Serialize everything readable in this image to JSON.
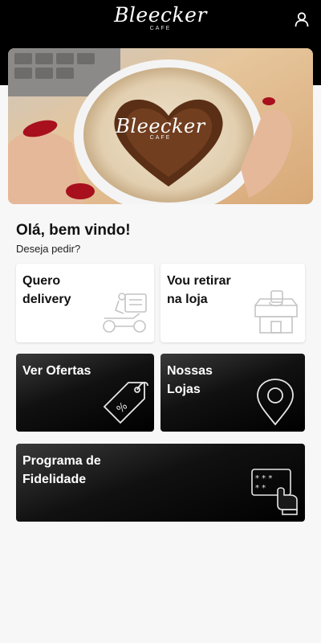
{
  "header": {
    "logo_text": "Bleecker",
    "logo_sub": "CAFE",
    "user_icon": "user-icon"
  },
  "hero": {
    "logo_text": "Bleecker",
    "logo_sub": "CAFE"
  },
  "greeting": {
    "title": "Olá, bem vindo!",
    "subtitle": "Deseja pedir?"
  },
  "cards": [
    {
      "label": "Quero\ndelivery",
      "icon": "delivery-scooter-icon",
      "style": "light"
    },
    {
      "label": "Vou retirar\nna loja",
      "icon": "store-pickup-icon",
      "style": "light"
    },
    {
      "label": "Ver Ofertas",
      "icon": "price-tag-icon",
      "style": "dark"
    },
    {
      "label": "Nossas\nLojas",
      "icon": "location-pin-icon",
      "style": "dark"
    },
    {
      "label": "Programa de\nFidelidade",
      "icon": "loyalty-card-icon",
      "style": "dark"
    }
  ],
  "colors": {
    "topbar": "#000000",
    "background": "#f7f7f7",
    "dark_card": "#000000",
    "light_card": "#ffffff"
  }
}
